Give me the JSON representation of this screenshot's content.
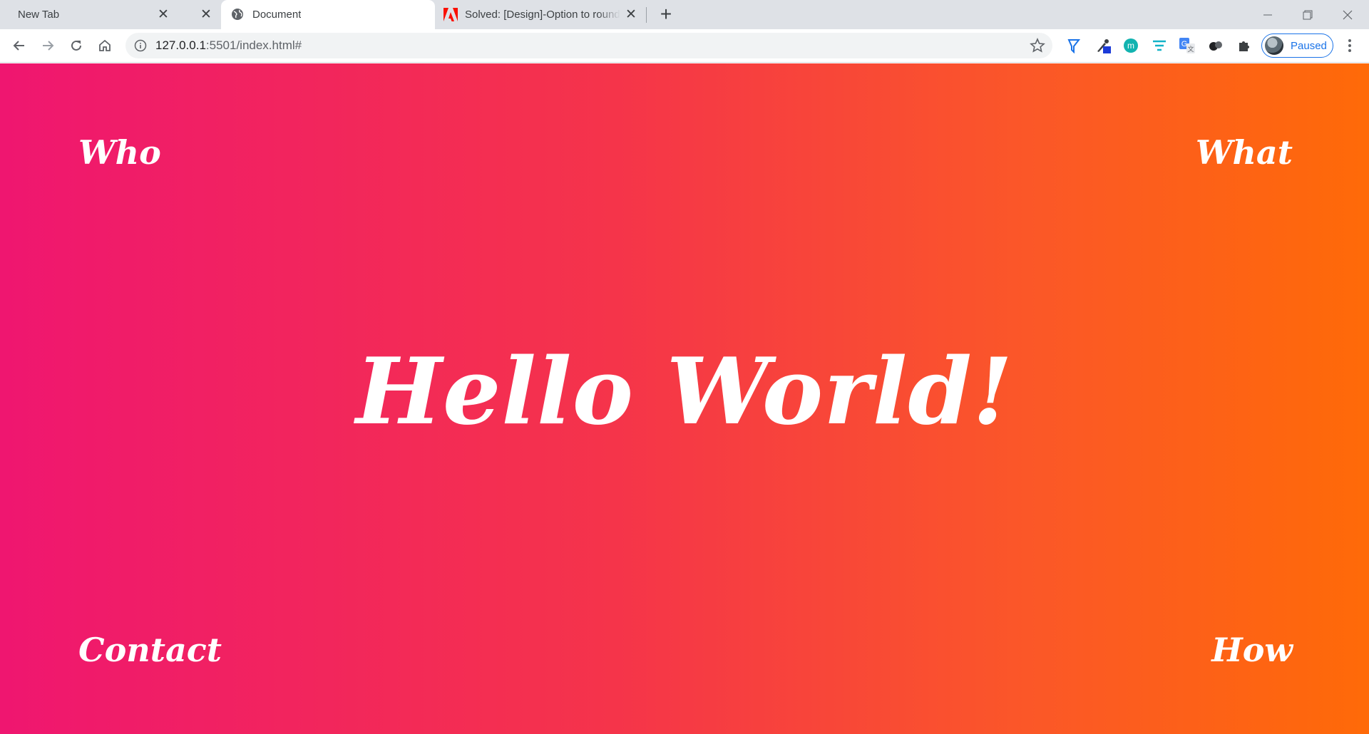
{
  "tabs": [
    {
      "title": "New Tab",
      "active": false
    },
    {
      "title": "Document",
      "active": true,
      "favicon": "globe-icon"
    },
    {
      "title": "Solved: [Design]-Option to round",
      "active": false,
      "favicon": "adobe-icon"
    }
  ],
  "omnibox": {
    "url_host": "127.0.0.1",
    "url_rest": ":5501/index.html#"
  },
  "profile": {
    "label": "Paused"
  },
  "page": {
    "nav": {
      "who": "Who",
      "what": "What",
      "contact": "Contact",
      "how": "How"
    },
    "hero": "Hello World!",
    "gradient": {
      "from": "#ef1670",
      "to": "#ff6a08"
    }
  },
  "colors": {
    "accent": "#1a73e8",
    "text_on_page": "#ffffff"
  }
}
